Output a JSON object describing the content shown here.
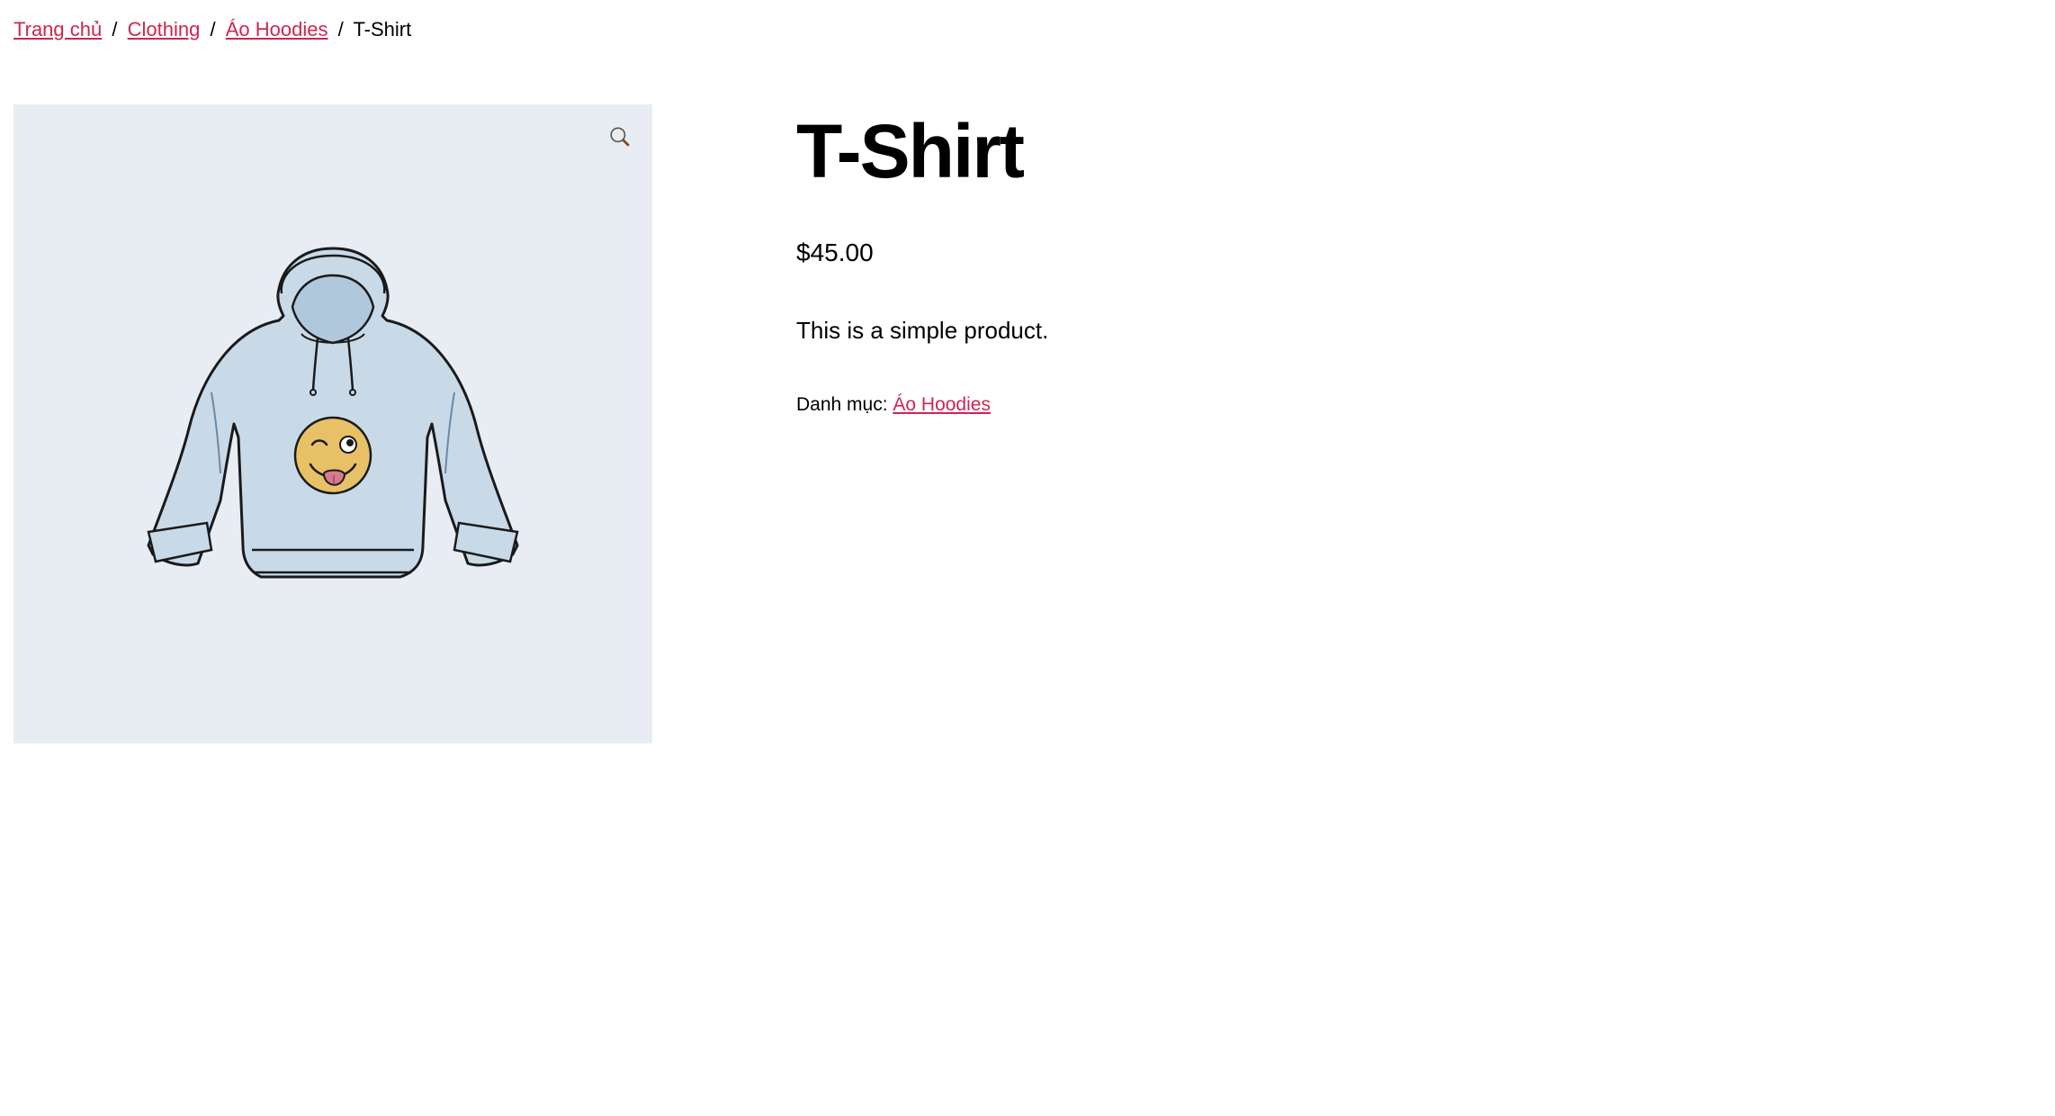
{
  "breadcrumb": {
    "home": "Trang chủ",
    "clothing": "Clothing",
    "hoodies": "Áo Hoodies",
    "current": "T-Shirt"
  },
  "product": {
    "title": "T-Shirt",
    "price": "$45.00",
    "description": "This is a simple product.",
    "category_label": "Danh mục: ",
    "category_link": "Áo Hoodies"
  }
}
